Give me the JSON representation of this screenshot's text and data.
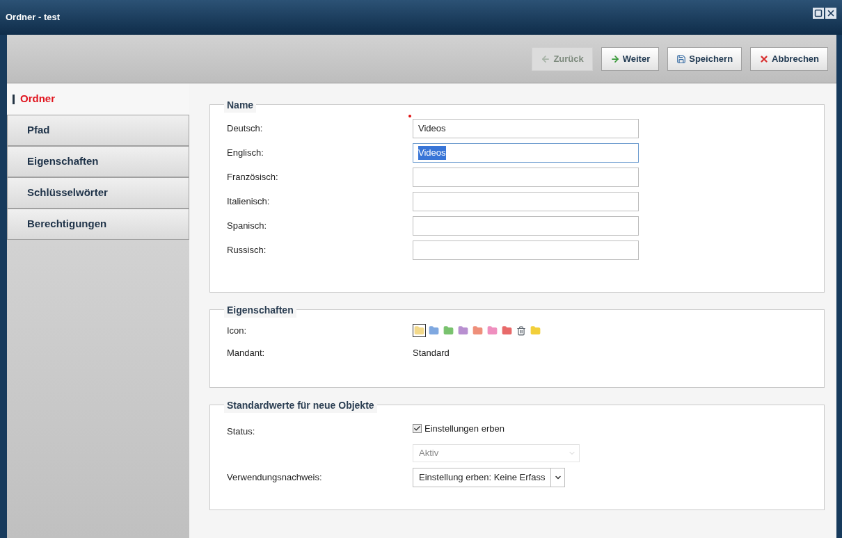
{
  "window": {
    "title": "Ordner - test"
  },
  "toolbar": [
    {
      "kind": "back",
      "label": "Zurück",
      "disabled": true
    },
    {
      "kind": "forward",
      "label": "Weiter",
      "disabled": false
    },
    {
      "kind": "save",
      "label": "Speichern",
      "disabled": false
    },
    {
      "kind": "cancel",
      "label": "Abbrechen",
      "disabled": false
    }
  ],
  "sidebar": {
    "items": [
      {
        "label": "Ordner",
        "selected": true
      },
      {
        "label": "Pfad",
        "selected": false
      },
      {
        "label": "Eigenschaften",
        "selected": false
      },
      {
        "label": "Schlüsselwörter",
        "selected": false
      },
      {
        "label": "Berechtigungen",
        "selected": false
      }
    ]
  },
  "name_section": {
    "title": "Name",
    "fields": [
      {
        "label": "Deutsch:",
        "value": "Videos",
        "required": true,
        "text_selected": false
      },
      {
        "label": "Englisch:",
        "value": "Videos",
        "required": false,
        "text_selected": true
      },
      {
        "label": "Französisch:",
        "required": false,
        "text_selected": false
      },
      {
        "label": "Italienisch:",
        "required": false,
        "text_selected": false
      },
      {
        "label": "Spanisch:",
        "required": false,
        "text_selected": false
      },
      {
        "label": "Russisch:",
        "required": false,
        "text_selected": false
      }
    ]
  },
  "properties_section": {
    "title": "Eigenschaften",
    "icon_label": "Icon:",
    "icons": [
      {
        "kind": "folder",
        "color": "#f3d98a",
        "selected": true
      },
      {
        "kind": "folder",
        "color": "#7fa8e0",
        "selected": false
      },
      {
        "kind": "folder",
        "color": "#79c26e",
        "selected": false
      },
      {
        "kind": "folder",
        "color": "#b88fd0",
        "selected": false
      },
      {
        "kind": "folder",
        "color": "#ee8f7a",
        "selected": false
      },
      {
        "kind": "folder",
        "color": "#ef8fbf",
        "selected": false
      },
      {
        "kind": "folder",
        "color": "#e86a6a",
        "selected": false
      },
      {
        "kind": "trash",
        "selected": false
      },
      {
        "kind": "folder",
        "color": "#f2cf3a",
        "selected": false
      }
    ],
    "client_label": "Mandant:",
    "client_value": "Standard"
  },
  "defaults_section": {
    "title": "Standardwerte für neue Objekte",
    "status_label": "Status:",
    "inherit_checkbox": {
      "label": "Einstellungen erben",
      "checked": true
    },
    "status_select": {
      "value": "Aktiv",
      "disabled": true
    },
    "usage_label": "Verwendungsnachweis:",
    "usage_select": {
      "value": "Einstellung erben: Keine Erfass",
      "disabled": false
    }
  }
}
